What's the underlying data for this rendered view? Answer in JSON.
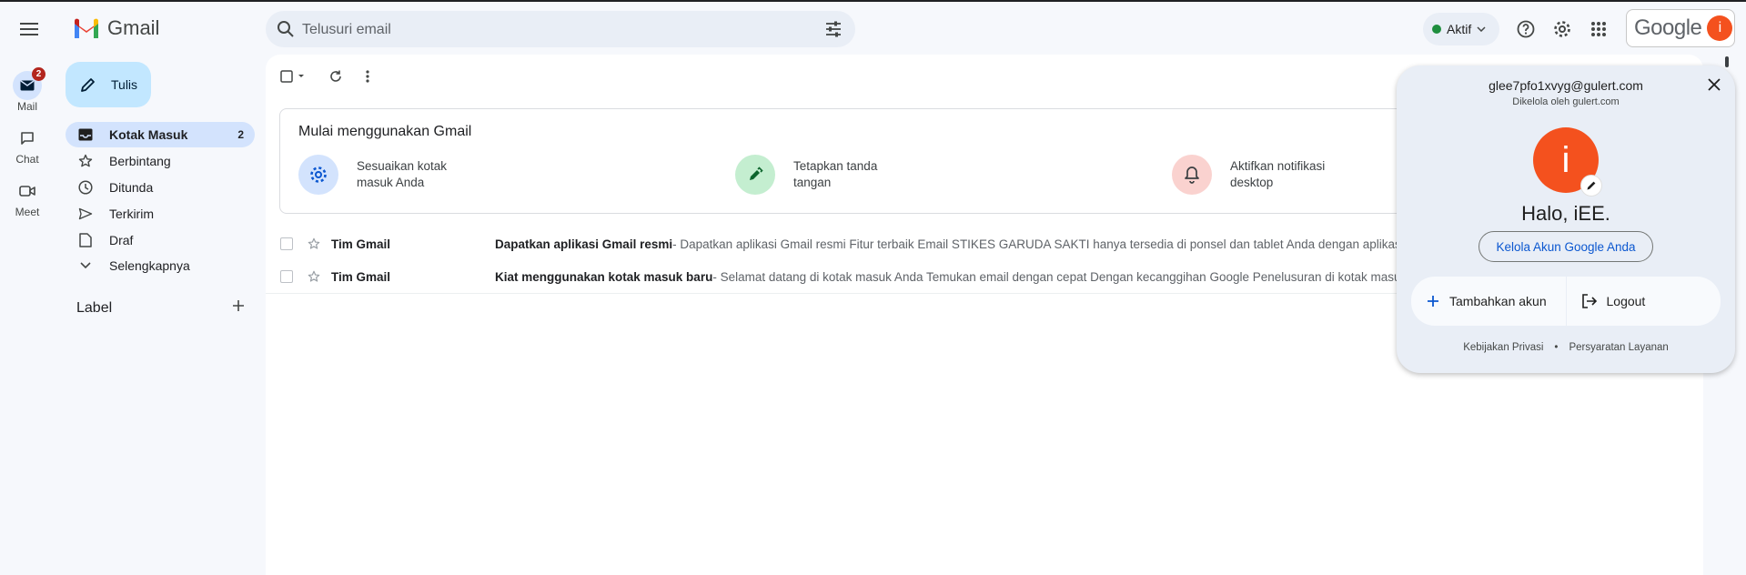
{
  "app": {
    "name": "Gmail"
  },
  "search": {
    "placeholder": "Telusuri email"
  },
  "status": {
    "label": "Aktif",
    "color": "#1e8e3e"
  },
  "google": {
    "word": "Google",
    "avatar_letter": "i"
  },
  "rail": [
    {
      "label": "Mail",
      "icon": "mail-icon",
      "badge": "2"
    },
    {
      "label": "Chat",
      "icon": "chat-icon"
    },
    {
      "label": "Meet",
      "icon": "video-icon"
    }
  ],
  "compose": {
    "label": "Tulis"
  },
  "nav": [
    {
      "label": "Kotak Masuk",
      "count": "2",
      "icon": "inbox-icon"
    },
    {
      "label": "Berbintang",
      "icon": "star-icon"
    },
    {
      "label": "Ditunda",
      "icon": "clock-icon"
    },
    {
      "label": "Terkirim",
      "icon": "send-icon"
    },
    {
      "label": "Draf",
      "icon": "draft-icon"
    },
    {
      "label": "Selengkapnya",
      "icon": "chevron-down-icon"
    }
  ],
  "labels": {
    "heading": "Label"
  },
  "getting_started": {
    "title": "Mulai menggunakan Gmail",
    "items": [
      {
        "text": "Sesuaikan kotak masuk Anda",
        "icon": "gear-icon",
        "color": "#d3e3fd"
      },
      {
        "text": "Tetapkan tanda tangan",
        "icon": "pen-icon",
        "color": "#c4eed0"
      },
      {
        "text": "Aktifkan notifikasi desktop",
        "icon": "bell-icon",
        "color": "#fad2cf"
      }
    ]
  },
  "emails": [
    {
      "sender": "Tim Gmail",
      "subject": "Dapatkan aplikasi Gmail resmi",
      "snippet": " - Dapatkan aplikasi Gmail resmi Fitur terbaik Email STIKES GARUDA SAKTI hanya tersedia di ponsel dan tablet Anda dengan aplikasi Gmail resmi"
    },
    {
      "sender": "Tim Gmail",
      "subject": "Kiat menggunakan kotak masuk baru",
      "snippet": " - Selamat datang di kotak masuk Anda Temukan email dengan cepat Dengan kecanggihan Google Penelusuran di kotak masuk, Anda d"
    }
  ],
  "account_popup": {
    "email": "glee7pfo1xvyg@gulert.com",
    "managed_by": "Dikelola oleh gulert.com",
    "avatar_letter": "i",
    "greeting": "Halo, iEE.",
    "manage_button": "Kelola Akun Google Anda",
    "add_account": "Tambahkan akun",
    "logout": "Logout",
    "privacy": "Kebijakan Privasi",
    "separator": "•",
    "terms": "Persyaratan Layanan"
  }
}
